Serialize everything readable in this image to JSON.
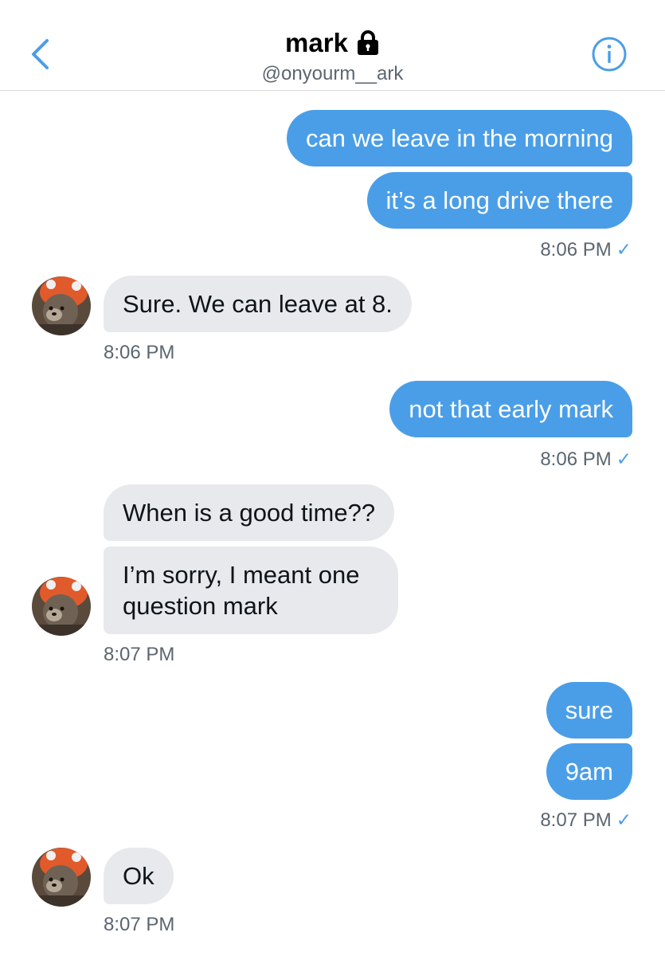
{
  "header": {
    "name": "mark",
    "handle": "@onyourm__ark"
  },
  "messages": {
    "m1": "can we leave in the morning",
    "m2": "it’s a long drive there",
    "t1": "8:06 PM",
    "m3": "Sure. We can leave at 8.",
    "t2": "8:06 PM",
    "m4": "not that early mark",
    "t3": "8:06 PM",
    "m5": "When is a good time??",
    "m6_line1": "I’m sorry, I meant one",
    "m6_line2": "question mark",
    "t4": "8:07 PM",
    "m7": "sure",
    "m8": "9am",
    "t5": "8:07 PM",
    "m9": "Ok",
    "t6": "8:07 PM"
  },
  "colors": {
    "accent": "#4a9ee8",
    "incoming_bubble": "#e7e9ed",
    "secondary_text": "#5b6670"
  },
  "icons": {
    "back": "chevron-left-icon",
    "lock": "lock-icon",
    "info": "info-icon",
    "read": "checkmark-icon"
  }
}
